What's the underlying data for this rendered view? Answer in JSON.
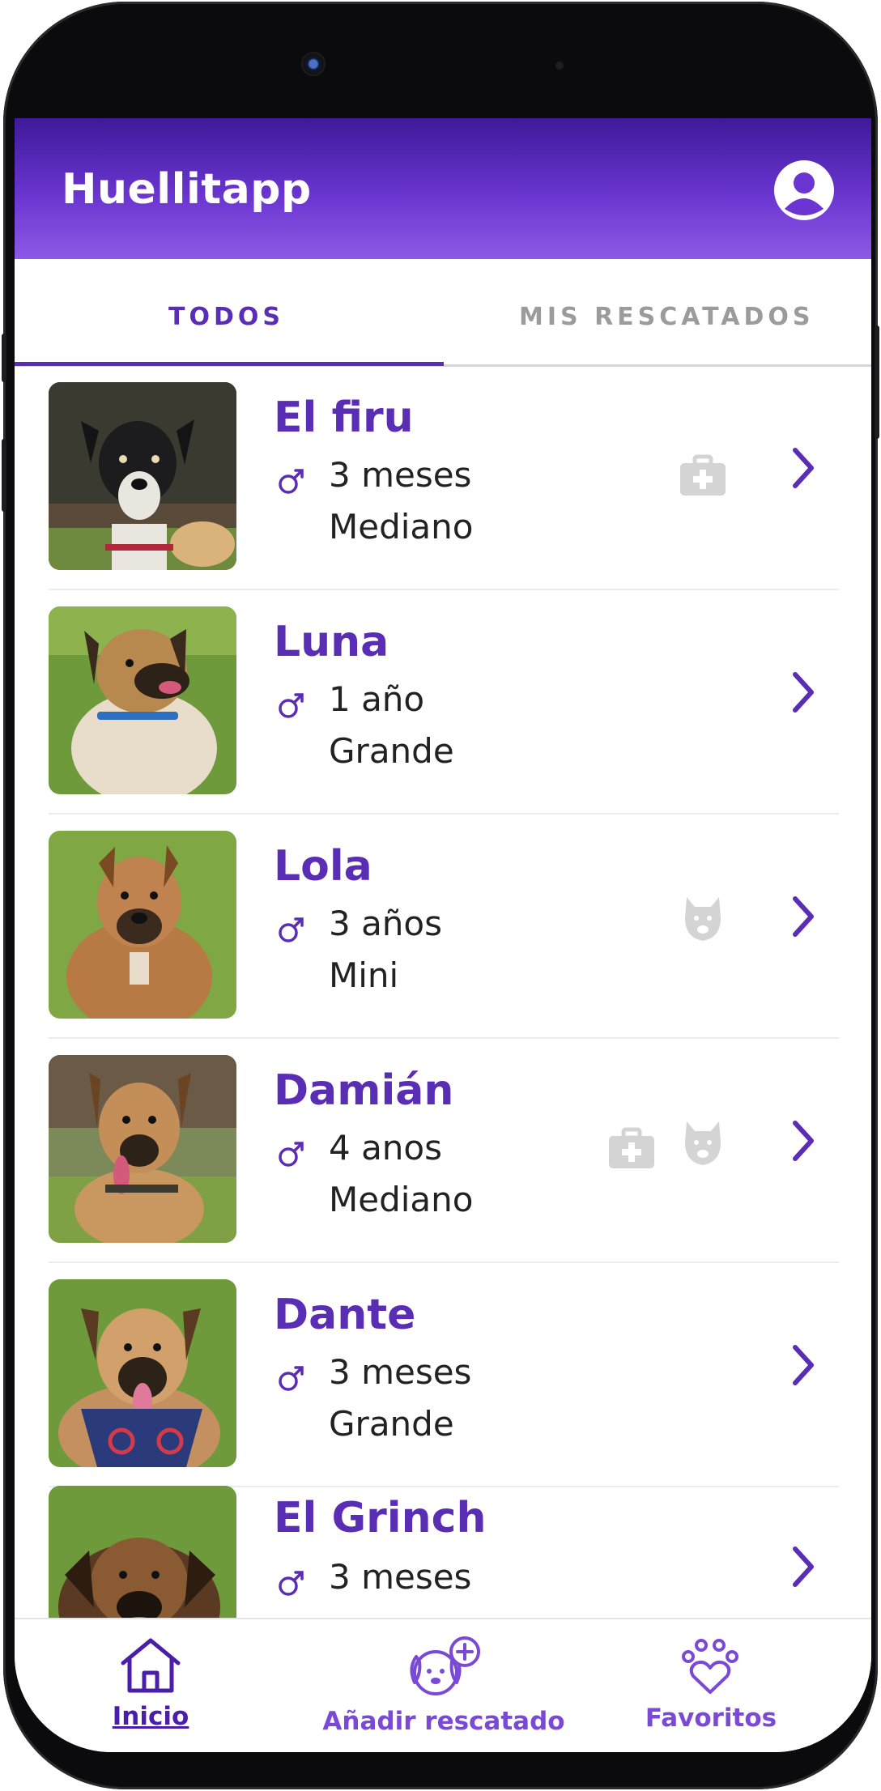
{
  "app": {
    "title": "Huellitapp"
  },
  "tabs": [
    {
      "label": "TODOS",
      "selected": true
    },
    {
      "label": "MIS RESCATADOS",
      "selected": false
    }
  ],
  "pets": [
    {
      "name": "El firu",
      "sex": "male",
      "age": "3 meses",
      "size": "Mediano",
      "badges": [
        "medical-kit-icon"
      ]
    },
    {
      "name": "Luna",
      "sex": "male",
      "age": "1 año",
      "size": "Grande",
      "badges": []
    },
    {
      "name": "Lola",
      "sex": "male",
      "age": "3 años",
      "size": "Mini",
      "badges": [
        "dangerous-breed-icon"
      ]
    },
    {
      "name": "Damián",
      "sex": "male",
      "age": "4 anos",
      "size": "Mediano",
      "badges": [
        "medical-kit-icon",
        "dangerous-breed-icon"
      ]
    },
    {
      "name": "Dante",
      "sex": "male",
      "age": "3 meses",
      "size": "Grande",
      "badges": []
    },
    {
      "name": "El Grinch",
      "sex": "male",
      "age": "3 meses",
      "size": "",
      "badges": []
    }
  ],
  "bottom_nav": [
    {
      "label": "Inicio",
      "icon": "home-icon",
      "active": true
    },
    {
      "label": "Añadir rescatado",
      "icon": "add-dog-icon",
      "active": false
    },
    {
      "label": "Favoritos",
      "icon": "paw-heart-icon",
      "active": false
    }
  ],
  "colors": {
    "primary": "#5a2db5",
    "appbar_top": "#3e1a9a",
    "appbar_bottom": "#8c5ae6",
    "badge_gray": "#d4d4d4"
  }
}
